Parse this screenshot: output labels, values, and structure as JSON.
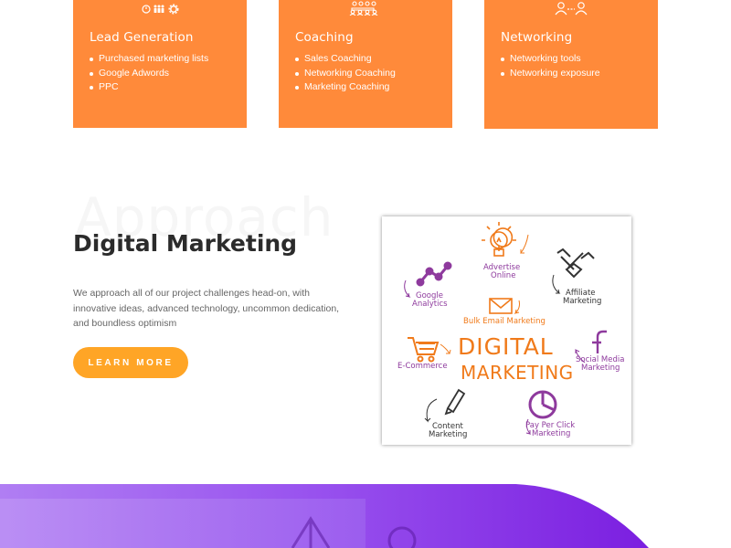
{
  "cards": [
    {
      "title": "Lead Generation",
      "icon": "analytics-people-icon",
      "items": [
        "Purchased marketing lists",
        "Google Adwords",
        "PPC"
      ]
    },
    {
      "title": "Coaching",
      "icon": "group-people-icon",
      "items": [
        "Sales Coaching",
        "Networking Coaching",
        "Marketing Coaching"
      ]
    },
    {
      "title": "Networking",
      "icon": "connected-people-icon",
      "items": [
        "Networking tools",
        "Networking exposure"
      ]
    }
  ],
  "section": {
    "ghost_text": "Approach",
    "title": "Digital Marketing",
    "description": "We approach all of our project challenges head-on, with innovative ideas, advanced technology, uncommon dedication, and boundless optimism",
    "button_label": "LEARN MORE"
  },
  "dm_image": {
    "headline_line1": "DIGITAL",
    "headline_line2": "MARKETING",
    "labels": {
      "advertise": "Advertise",
      "online": "Online",
      "google": "Google",
      "analytics": "Analytics",
      "affiliate": "Affiliate",
      "marketing_aff": "Marketing",
      "bulk_email": "Bulk Email Marketing",
      "ecommerce": "E-Commerce",
      "social": "Social Media",
      "marketing_soc": "Marketing",
      "content": "Content",
      "marketing_con": "Marketing",
      "ppc": "Pay Per Click",
      "marketing_ppc": "Marketing"
    }
  },
  "colors": {
    "card_orange": "#ff8a3a",
    "button_orange": "#ffa526",
    "purple": "#8a2be2",
    "dm_orange": "#f07a1a",
    "dm_purple": "#8e3a9d"
  }
}
